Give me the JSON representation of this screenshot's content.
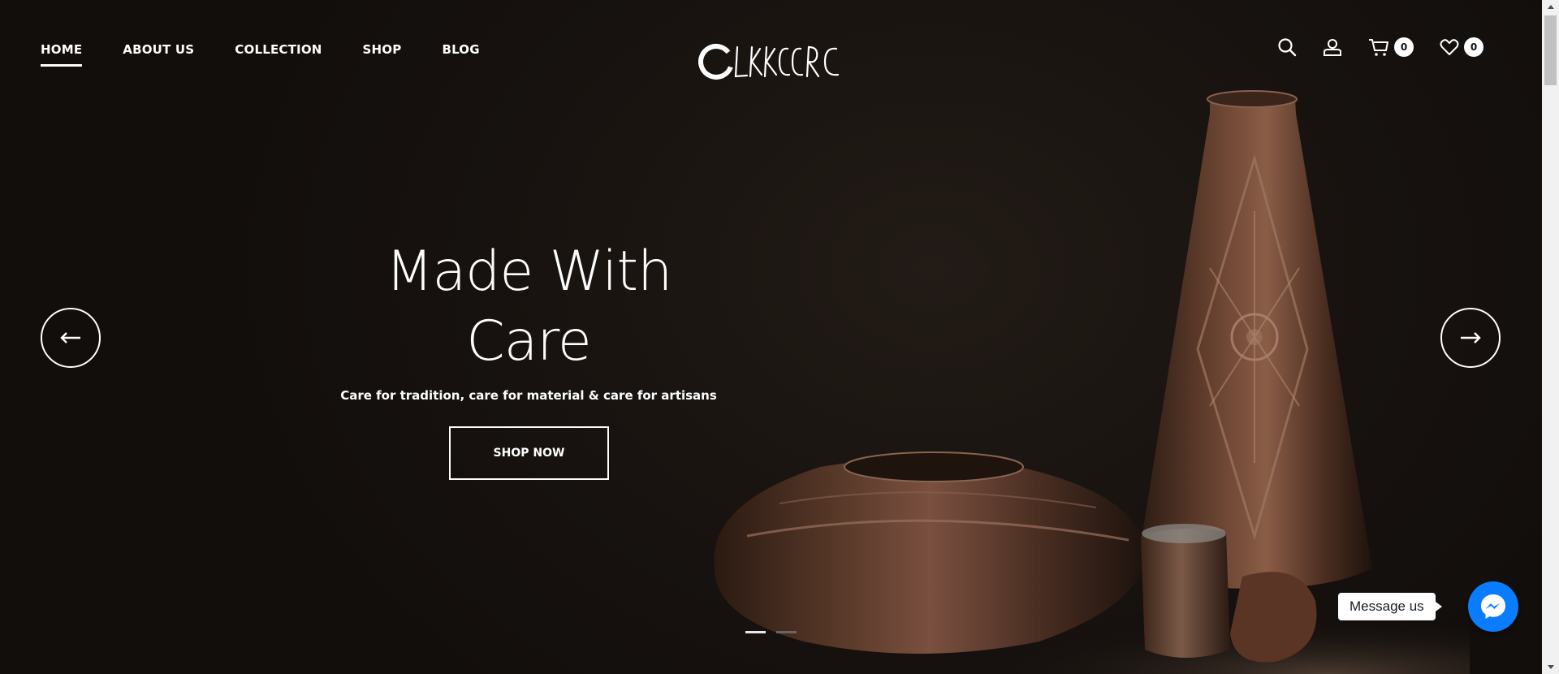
{
  "nav": {
    "items": [
      {
        "label": "HOME",
        "active": true
      },
      {
        "label": "ABOUT US",
        "active": false
      },
      {
        "label": "COLLECTION",
        "active": false
      },
      {
        "label": "SHOP",
        "active": false
      },
      {
        "label": "BLOG",
        "active": false
      }
    ]
  },
  "logo": {
    "text": "CAKKERC"
  },
  "header_icons": {
    "search_icon": "search-icon",
    "account_icon": "user-icon",
    "cart": {
      "icon": "cart-icon",
      "count": "0"
    },
    "wishlist": {
      "icon": "heart-icon",
      "count": "0"
    }
  },
  "hero": {
    "headline_line1": "Made With",
    "headline_line2": "Care",
    "subline": "Care for tradition, care for material & care for artisans",
    "cta_label": "SHOP NOW",
    "slides_total": 2,
    "active_slide": 1
  },
  "messenger": {
    "label": "Message us",
    "icon": "messenger-icon"
  },
  "colors": {
    "background": "#17120f",
    "text": "#ffffff",
    "messenger_blue": "#0a7cff"
  }
}
